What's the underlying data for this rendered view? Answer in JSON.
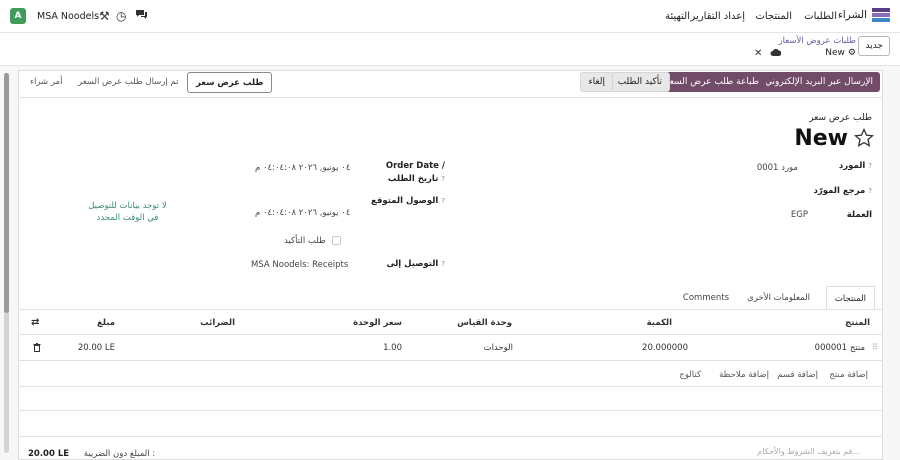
{
  "topbar": {
    "app_name": "الشراء",
    "menu": [
      "الطلبات",
      "المنتجات",
      "إعداد التقارير",
      "التهيئة"
    ],
    "company": "MSA Noodels",
    "avatar_letter": "A",
    "icons": [
      "chat-icon",
      "clock-icon",
      "tools-icon"
    ]
  },
  "control_panel": {
    "new_button": "جديد",
    "breadcrumb_parent": "طلبات عروض الأسعار",
    "breadcrumb_current": "New"
  },
  "header_buttons": {
    "send_email": "الإرسال عبر البريد الإلكتروني",
    "print_rfq": "طباعة طلب عرض السعر",
    "confirm_order": "تأكيد الطلب",
    "cancel": "إلغاء"
  },
  "statusbar": {
    "stages": [
      "طلب عرض سعر",
      "تم إرسال طلب عرض السعر",
      "أمر شراء"
    ],
    "active_index": 0
  },
  "form": {
    "subtitle": "طلب عرض سعر",
    "title": "New",
    "supplier_label": "المورد",
    "supplier_value": "مورد 0001",
    "supplier_ref_label": "مرجع المورّد",
    "currency_label": "العملة",
    "currency_value": "EGP",
    "order_date_label": "Order Date / تاريخ الطلب",
    "order_date_value": "٠٤ يونيو, ٢٠٢٦ ٠٤:٠٤:٠٨ م",
    "expected_arrival_label": "الوصول المتوقع",
    "expected_arrival_value": "٠٤ يونيو, ٢٠٢٦ ٠٤:٠٤:٠٨ م",
    "ask_confirmation_label": "طلب التأكيد",
    "deliver_to_label": "التوصيل إلى",
    "deliver_to_value": "MSA Noodels: Receipts",
    "on_time_note": "لا توجد بيانات للتوصيل في الوقت المحدد"
  },
  "tabs": [
    "المنتجات",
    "المعلومات الأخرى",
    "Comments"
  ],
  "lines": {
    "headers": [
      "المنتج",
      "الكمية",
      "وحدة القياس",
      "سعر الوحدة",
      "الضرائب",
      "مبلغ"
    ],
    "rows": [
      {
        "product": "منتج 000001",
        "quantity": "20.000000",
        "uom": "الوحدات",
        "price_unit": "1.00",
        "taxes": "",
        "subtotal": "20.00 LE"
      }
    ],
    "add_product": "إضافة منتج",
    "add_section": "إضافة قسم",
    "add_note": "إضافة ملاحظة",
    "catalog": "كتالوج"
  },
  "footer": {
    "terms_placeholder": "قم بتعريف الشروط والأحكام...",
    "untaxed_label": "المبلغ دون الضريبة :",
    "untaxed_value": "20.00 LE"
  },
  "colors": {
    "primary": "#714b67",
    "link": "#6b5aa0",
    "note": "#3a8a7a"
  }
}
